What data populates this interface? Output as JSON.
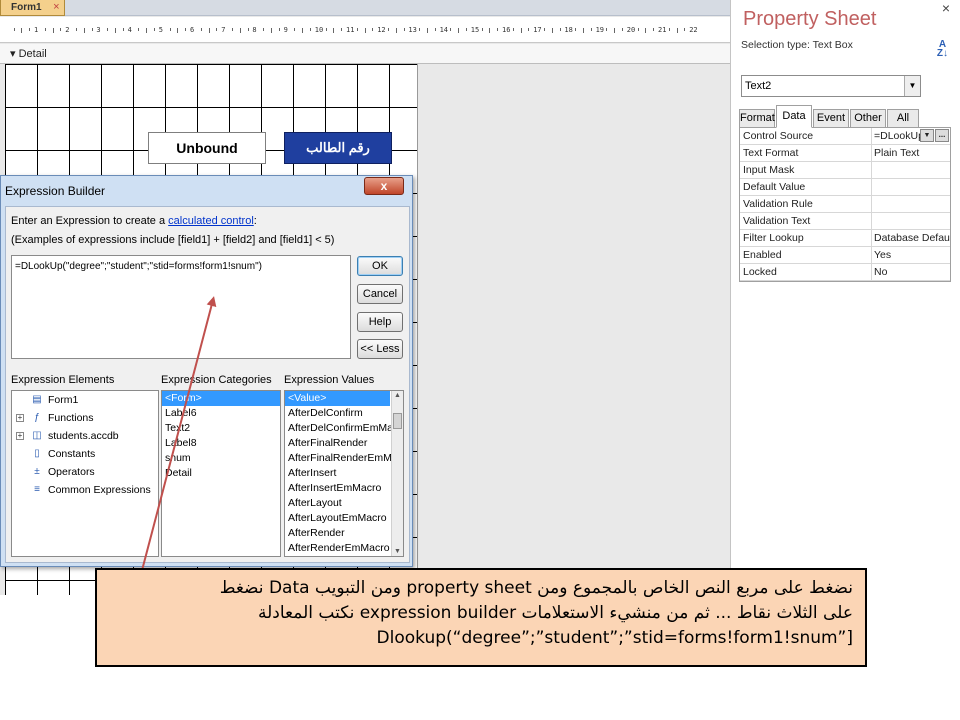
{
  "design": {
    "tab_label": "Form1",
    "tab_close": "×",
    "section_label": "Detail",
    "ruler_ticks": [
      "1",
      "2",
      "3",
      "4",
      "5",
      "6",
      "7",
      "8",
      "9",
      "10",
      "11",
      "12",
      "13",
      "14",
      "15",
      "16",
      "17",
      "18",
      "19",
      "20",
      "21",
      "22"
    ],
    "unbound_label": "Unbound",
    "arabic_label": "رقم الطالب"
  },
  "dialog": {
    "title": "Expression Builder",
    "close_symbol": "x",
    "hint_prefix": "Enter an Expression to create a ",
    "hint_link": "calculated control",
    "hint_suffix": ":",
    "hint_examples": "(Examples of expressions include [field1] + [field2] and [field1] < 5)",
    "expression": "=DLookUp(\"degree\";\"student\";\"stid=forms!form1!snum\")",
    "buttons": {
      "ok": "OK",
      "cancel": "Cancel",
      "help": "Help",
      "less": "<< Less"
    },
    "elements_label": "Expression Elements",
    "categories_label": "Expression Categories",
    "values_label": "Expression Values",
    "elements": [
      {
        "label": "Form1",
        "expandable": false,
        "icon": "form-icon"
      },
      {
        "label": "Functions",
        "expandable": true,
        "icon": "function-icon"
      },
      {
        "label": "students.accdb",
        "expandable": true,
        "icon": "database-icon"
      },
      {
        "label": "Constants",
        "expandable": false,
        "icon": "constants-icon"
      },
      {
        "label": "Operators",
        "expandable": false,
        "icon": "operators-icon"
      },
      {
        "label": "Common Expressions",
        "expandable": false,
        "icon": "common-expressions-icon"
      }
    ],
    "categories": [
      "<Form>",
      "Label6",
      "Text2",
      "Label8",
      "snum",
      "Detail"
    ],
    "values": [
      "<Value>",
      "AfterDelConfirm",
      "AfterDelConfirmEmMacro",
      "AfterFinalRender",
      "AfterFinalRenderEmMacr",
      "AfterInsert",
      "AfterInsertEmMacro",
      "AfterLayout",
      "AfterLayoutEmMacro",
      "AfterRender",
      "AfterRenderEmMacro"
    ]
  },
  "property_sheet": {
    "title": "Property Sheet",
    "close_symbol": "×",
    "selection_type": "Selection type:  Text Box",
    "sort_icon_text": "A↓Z",
    "selected_control": "Text2",
    "tabs": [
      "Format",
      "Data",
      "Event",
      "Other",
      "All"
    ],
    "active_tab": "Data",
    "rows": [
      {
        "name": "Control Source",
        "value": "=DLookUp"
      },
      {
        "name": "Text Format",
        "value": "Plain Text"
      },
      {
        "name": "Input Mask",
        "value": ""
      },
      {
        "name": "Default Value",
        "value": ""
      },
      {
        "name": "Validation Rule",
        "value": ""
      },
      {
        "name": "Validation Text",
        "value": ""
      },
      {
        "name": "Filter Lookup",
        "value": "Database Default"
      },
      {
        "name": "Enabled",
        "value": "Yes"
      },
      {
        "name": "Locked",
        "value": "No"
      }
    ],
    "build_button": "...",
    "dropdown_symbol": "▼"
  },
  "caption": {
    "line1": "نضغط على مربع النص الخاص بالمجموع ومن property sheet ومن التبويب Data نضغط",
    "line2": "على الثلاث نقاط ... ثم من منشيء الاستعلامات expression builder نكتب المعادلة",
    "line3": "Dlookup(“degree”;”student”;”stid=forms!form1!snum”]"
  },
  "colors": {
    "caption_bg": "#fbd5b5",
    "arrow": "#c0504d",
    "label_blue": "#1f3f9f",
    "title_red": "#c06060"
  }
}
